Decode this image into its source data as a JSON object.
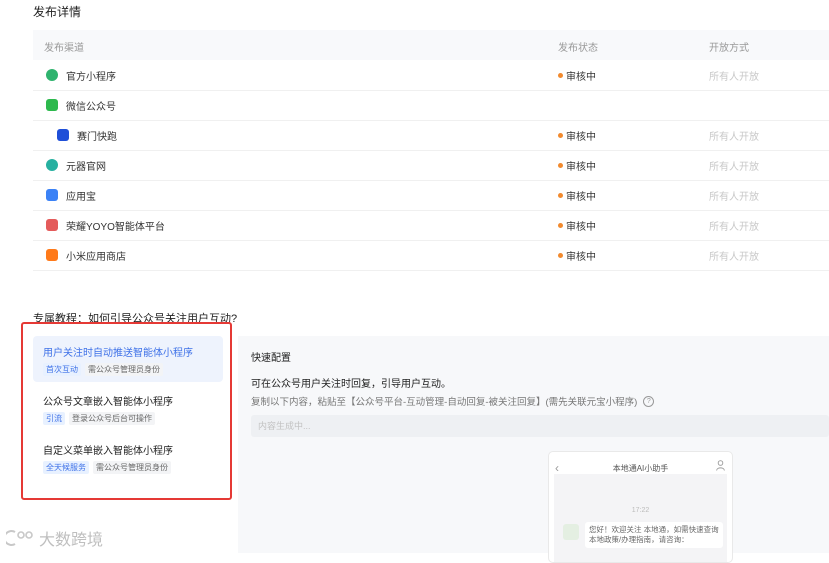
{
  "page": {
    "title": "发布详情"
  },
  "table": {
    "headers": {
      "channel": "发布渠道",
      "status": "发布状态",
      "mode": "开放方式"
    },
    "rows": [
      {
        "name": "官方小程序",
        "status": "审核中",
        "mode": "所有人开放",
        "icon": "mini-program-icon",
        "color": "#2fb36e",
        "indent": false
      },
      {
        "name": "微信公众号",
        "status": "",
        "mode": "",
        "icon": "wechat-official-icon",
        "color": "#2db94d",
        "indent": false
      },
      {
        "name": "赛门快跑",
        "status": "审核中",
        "mode": "所有人开放",
        "icon": "saimen-icon",
        "color": "#1f4fd8",
        "indent": true
      },
      {
        "name": "元器官网",
        "status": "审核中",
        "mode": "所有人开放",
        "icon": "yuanqi-icon",
        "color": "#27b0a0",
        "indent": false
      },
      {
        "name": "应用宝",
        "status": "审核中",
        "mode": "所有人开放",
        "icon": "yingyongbao-icon",
        "color": "#3b82f6",
        "indent": false
      },
      {
        "name": "荣耀YOYO智能体平台",
        "status": "审核中",
        "mode": "所有人开放",
        "icon": "honor-yoyo-icon",
        "color": "#e45b5b",
        "indent": false
      },
      {
        "name": "小米应用商店",
        "status": "审核中",
        "mode": "所有人开放",
        "icon": "xiaomi-store-icon",
        "color": "#ff7a1a",
        "indent": false
      }
    ]
  },
  "tutorial": {
    "title": "专属教程：如何引导公众号关注用户互动?",
    "items": [
      {
        "title": "用户关注时自动推送智能体小程序",
        "tag1": "首次互动",
        "tag2": "需公众号管理员身份",
        "active": true
      },
      {
        "title": "公众号文章嵌入智能体小程序",
        "tag1": "引流",
        "tag2": "登录公众号后台可操作",
        "active": false
      },
      {
        "title": "自定义菜单嵌入智能体小程序",
        "tag1": "全天候服务",
        "tag2": "需公众号管理员身份",
        "active": false
      }
    ]
  },
  "panel": {
    "heading": "快速配置",
    "subtitle": "可在公众号用户关注时回复，引导用户互动。",
    "copy_text": "复制以下内容，粘贴至【公众号平台-互动管理-自动回复-被关注回复】(需先关联元宝小程序)",
    "input_placeholder": "内容生成中...",
    "preview": {
      "title": "本地通AI小助手",
      "time": "17:22",
      "message": "您好！欢迎关注 本地通，如需快速查询本地政策/办理指南，请咨询："
    }
  },
  "watermark": {
    "text": "大数跨境"
  }
}
